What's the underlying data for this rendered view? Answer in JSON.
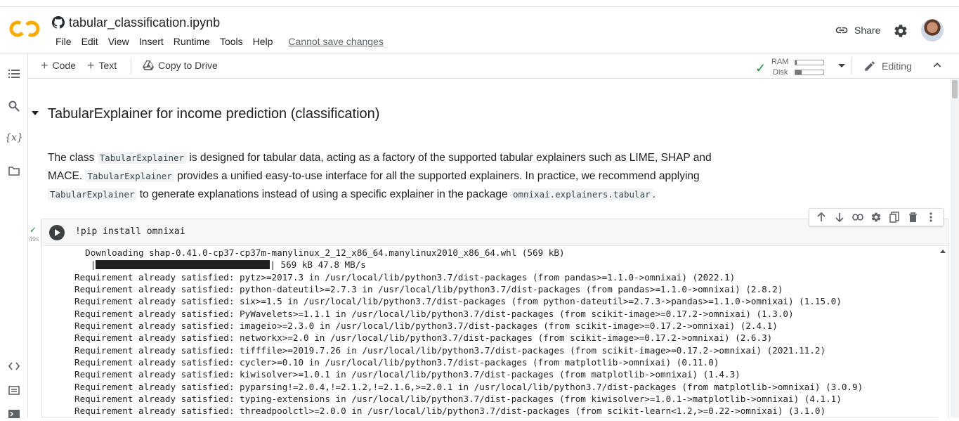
{
  "header": {
    "notebook_title": "tabular_classification.ipynb",
    "menu": [
      "File",
      "Edit",
      "View",
      "Insert",
      "Runtime",
      "Tools",
      "Help"
    ],
    "save_status": "Cannot save changes",
    "share_label": "Share"
  },
  "toolbar": {
    "code_label": "Code",
    "text_label": "Text",
    "copy_to_drive_label": "Copy to Drive",
    "ram_label": "RAM",
    "disk_label": "Disk",
    "ram_usage": 0.05,
    "disk_usage": 0.22,
    "editing_label": "Editing"
  },
  "notebook": {
    "section_heading": "TabularExplainer for income prediction (classification)",
    "paragraph": {
      "t1": "The class ",
      "c1": "TabularExplainer",
      "t2": " is designed for tabular data, acting as a factory of the supported tabular explainers such as LIME, SHAP and MACE. ",
      "c2": "TabularExplainer",
      "t3": " provides a unified easy-to-use interface for all the supported explainers. In practice, we recommend applying ",
      "c3": "TabularExplainer",
      "t4": " to generate explanations instead of using a specific explainer in the package ",
      "c4": "omnixai.explainers.tabular",
      "t5": "."
    },
    "cell": {
      "source": "!pip install omnixai",
      "exec_time": "49s",
      "output": {
        "download_line": "  Downloading shap-0.41.0-cp37-cp37m-manylinux_2_12_x86_64.manylinux2010_x86_64.whl (569 kB)",
        "progress_text": "| 569 kB 47.8 MB/s",
        "lines": [
          "Requirement already satisfied: pytz>=2017.3 in /usr/local/lib/python3.7/dist-packages (from pandas>=1.1.0->omnixai) (2022.1)",
          "Requirement already satisfied: python-dateutil>=2.7.3 in /usr/local/lib/python3.7/dist-packages (from pandas>=1.1.0->omnixai) (2.8.2)",
          "Requirement already satisfied: six>=1.5 in /usr/local/lib/python3.7/dist-packages (from python-dateutil>=2.7.3->pandas>=1.1.0->omnixai) (1.15.0)",
          "Requirement already satisfied: PyWavelets>=1.1.1 in /usr/local/lib/python3.7/dist-packages (from scikit-image>=0.17.2->omnixai) (1.3.0)",
          "Requirement already satisfied: imageio>=2.3.0 in /usr/local/lib/python3.7/dist-packages (from scikit-image>=0.17.2->omnixai) (2.4.1)",
          "Requirement already satisfied: networkx>=2.0 in /usr/local/lib/python3.7/dist-packages (from scikit-image>=0.17.2->omnixai) (2.6.3)",
          "Requirement already satisfied: tifffile>=2019.7.26 in /usr/local/lib/python3.7/dist-packages (from scikit-image>=0.17.2->omnixai) (2021.11.2)",
          "Requirement already satisfied: cycler>=0.10 in /usr/local/lib/python3.7/dist-packages (from matplotlib->omnixai) (0.11.0)",
          "Requirement already satisfied: kiwisolver>=1.0.1 in /usr/local/lib/python3.7/dist-packages (from matplotlib->omnixai) (1.4.3)",
          "Requirement already satisfied: pyparsing!=2.0.4,!=2.1.2,!=2.1.6,>=2.0.1 in /usr/local/lib/python3.7/dist-packages (from matplotlib->omnixai) (3.0.9)",
          "Requirement already satisfied: typing-extensions in /usr/local/lib/python3.7/dist-packages (from kiwisolver>=1.0.1->matplotlib->omnixai) (4.1.1)",
          "Requirement already satisfied: threadpoolctl>=2.0.0 in /usr/local/lib/python3.7/dist-packages (from scikit-learn<1.2,>=0.22->omnixai) (3.1.0)"
        ]
      }
    }
  },
  "icons": {
    "sidebar": [
      "toc-icon",
      "search-icon",
      "variables-icon",
      "folder-icon",
      "code-snippets-icon",
      "command-palette-icon",
      "terminal-icon"
    ],
    "cell_toolbar": [
      "arrow-up-icon",
      "arrow-down-icon",
      "link-icon",
      "settings-icon",
      "mirror-cell-icon",
      "delete-icon",
      "more-vert-icon"
    ]
  }
}
